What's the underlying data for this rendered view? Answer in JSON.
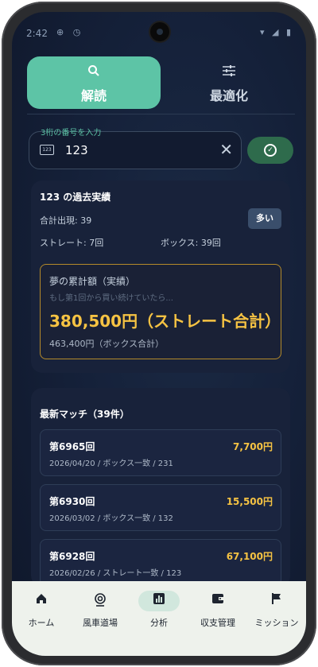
{
  "status_bar": {
    "time": "2:42",
    "left_icons": "⊕ ◷",
    "right_icons": "▾ ◢ ▮"
  },
  "tabs": [
    {
      "label": "解読",
      "icon": "search-icon",
      "active": true
    },
    {
      "label": "最適化",
      "icon": "tune-icon",
      "active": false
    }
  ],
  "input": {
    "label": "3桁の番号を入力",
    "value": "123",
    "icon_text": "123"
  },
  "stats": {
    "title": "123 の過去実績",
    "total": "合計出現: 39",
    "badge": "多い",
    "straight": "ストレート: 7回",
    "box": "ボックス: 39回"
  },
  "dream": {
    "title": "夢の累計額（実績）",
    "subtitle": "もし第1回から買い続けていたら...",
    "straight_total": "380,500円（ストレート合計）",
    "box_total": "463,400円（ボックス合計）"
  },
  "matches": {
    "title": "最新マッチ（39件）",
    "items": [
      {
        "name": "第6965回",
        "prize": "7,700円",
        "detail": "2026/04/20 / ボックス一致 / 231"
      },
      {
        "name": "第6930回",
        "prize": "15,500円",
        "detail": "2026/03/02 / ボックス一致 / 132"
      },
      {
        "name": "第6928回",
        "prize": "67,100円",
        "detail": "2026/02/26 / ストレート一致 / 123"
      }
    ]
  },
  "nav": [
    {
      "label": "ホーム",
      "icon": "home-icon",
      "active": false
    },
    {
      "label": "風車道場",
      "icon": "windmill-icon",
      "active": false
    },
    {
      "label": "分析",
      "icon": "analytics-icon",
      "active": true
    },
    {
      "label": "収支管理",
      "icon": "wallet-icon",
      "active": false
    },
    {
      "label": "ミッション",
      "icon": "flag-icon",
      "active": false
    }
  ],
  "colors": {
    "accent": "#5dc4a6",
    "gold": "#f6c343",
    "background": "#15213a"
  }
}
